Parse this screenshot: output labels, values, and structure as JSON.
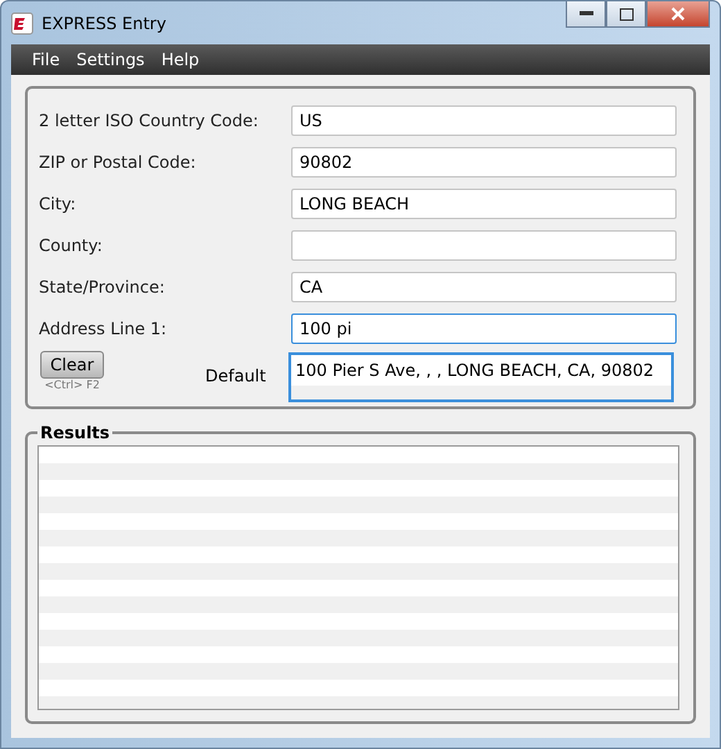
{
  "window": {
    "title": "EXPRESS Entry"
  },
  "menu": [
    "File",
    "Settings",
    "Help"
  ],
  "fields": [
    {
      "label": "2 letter ISO Country Code:",
      "value": "US",
      "focused": false
    },
    {
      "label": "ZIP or Postal Code:",
      "value": "90802",
      "focused": false
    },
    {
      "label": "City:",
      "value": "LONG BEACH",
      "focused": false
    },
    {
      "label": "County:",
      "focused": false
    },
    {
      "label": "State/Province:",
      "value": "CA",
      "focused": false
    },
    {
      "label": "Address Line 1:",
      "value": "100 pi",
      "focused": true
    }
  ],
  "suggestions": [
    "100 Pier S Ave, , , LONG BEACH, CA, 90802"
  ],
  "clear_button": {
    "label": "Clear",
    "shortcut": "<Ctrl> F2"
  },
  "mode_label": "Default",
  "results": {
    "title": "Results"
  }
}
